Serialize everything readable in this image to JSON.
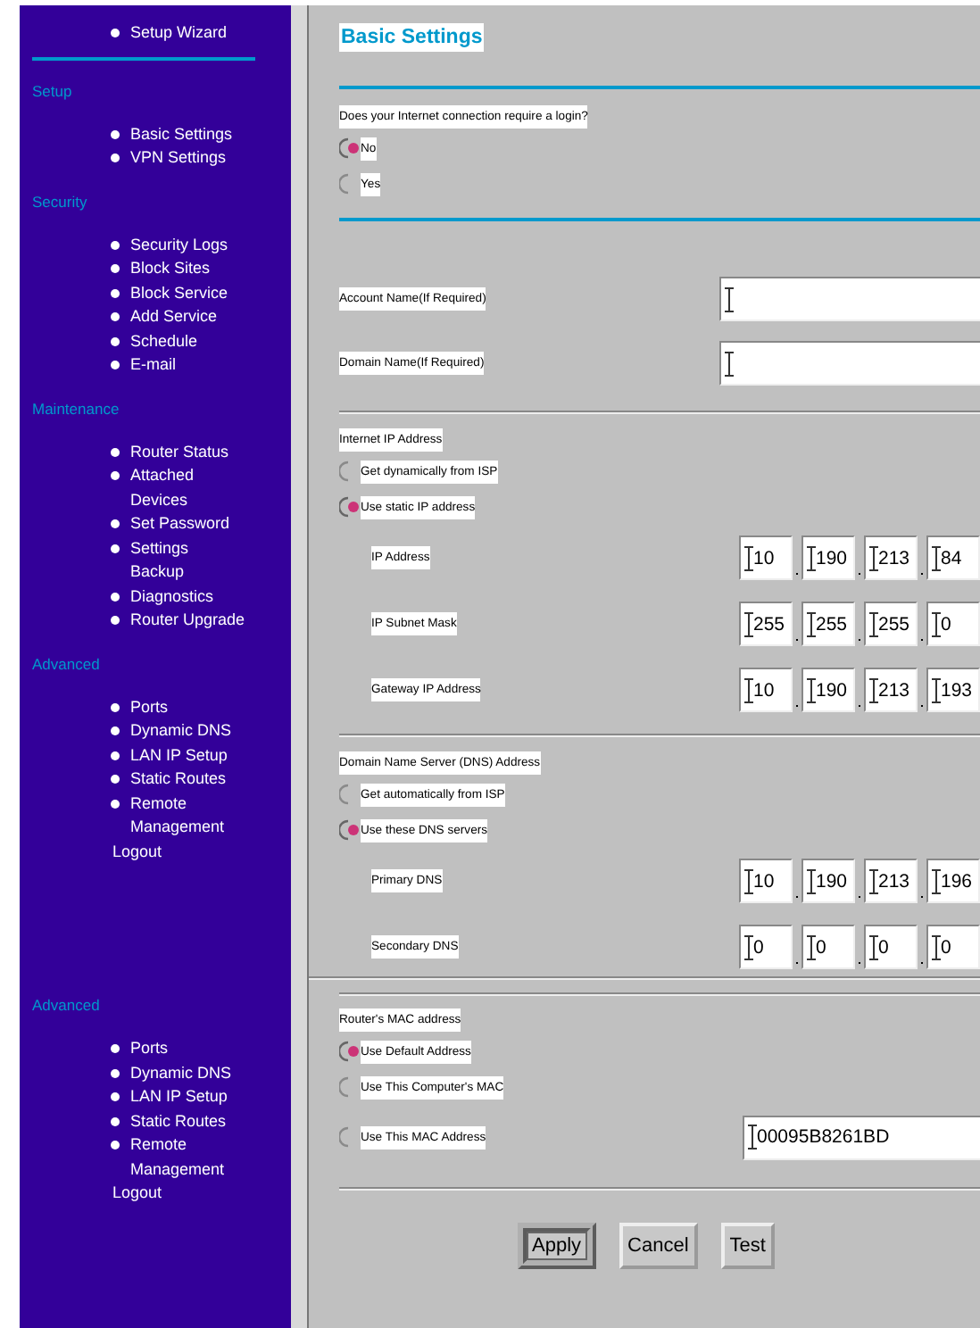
{
  "sidebar": {
    "top_item": {
      "label": "Setup Wizard"
    },
    "sections": [
      {
        "heading": "Setup",
        "items": [
          {
            "kind": "bullet",
            "label": "Basic Settings"
          },
          {
            "kind": "bullet",
            "label": "VPN Settings"
          }
        ]
      },
      {
        "heading": "Security",
        "items": [
          {
            "kind": "bullet",
            "label": "Security Logs"
          },
          {
            "kind": "bullet",
            "label": "Block Sites"
          },
          {
            "kind": "bullet",
            "label": "Block Service"
          },
          {
            "kind": "bullet",
            "label": "Add Service"
          },
          {
            "kind": "bullet",
            "label": "Schedule"
          },
          {
            "kind": "bullet",
            "label": "E-mail"
          }
        ]
      },
      {
        "heading": "Maintenance",
        "items": [
          {
            "kind": "bullet",
            "label": "Router Status"
          },
          {
            "kind": "bullet",
            "label": "Attached\nDevices"
          },
          {
            "kind": "bullet",
            "label": "Set Password"
          },
          {
            "kind": "bullet",
            "label": "Settings\nBackup"
          },
          {
            "kind": "bullet",
            "label": "Diagnostics"
          },
          {
            "kind": "bullet",
            "label": "Router Upgrade"
          }
        ]
      },
      {
        "heading": "Advanced",
        "items": [
          {
            "kind": "bullet",
            "label": "Ports"
          },
          {
            "kind": "bullet",
            "label": "Dynamic DNS"
          },
          {
            "kind": "bullet",
            "label": "LAN IP Setup"
          },
          {
            "kind": "bullet",
            "label": "Static Routes"
          },
          {
            "kind": "bullet",
            "label": "Remote\nManagement"
          },
          {
            "kind": "plain",
            "label": "Logout"
          }
        ]
      },
      {
        "heading": "Advanced",
        "items": [
          {
            "kind": "bullet",
            "label": "Ports"
          },
          {
            "kind": "bullet",
            "label": "Dynamic DNS"
          },
          {
            "kind": "bullet",
            "label": "LAN IP Setup"
          },
          {
            "kind": "bullet",
            "label": "Static Routes"
          },
          {
            "kind": "bullet",
            "label": "Remote\nManagement"
          },
          {
            "kind": "plain",
            "label": "Logout"
          }
        ]
      }
    ]
  },
  "title": "Basic Settings",
  "login": {
    "question": "Does your Internet connection require a login?",
    "options": [
      {
        "label": "No",
        "selected": true
      },
      {
        "label": "Yes",
        "selected": false
      }
    ]
  },
  "account_fields": [
    {
      "label": "Account Name(If Required)"
    },
    {
      "label": "Domain Name(If Required)"
    }
  ],
  "internet_ip": {
    "heading": "Internet IP Address",
    "options": [
      {
        "label": "Get dynamically from ISP",
        "selected": false
      },
      {
        "label": "Use static IP address",
        "selected": true
      }
    ],
    "fields": [
      {
        "label": "IP Address",
        "octets": [
          "10",
          "190",
          "213",
          "84"
        ]
      },
      {
        "label": "IP Subnet Mask",
        "octets": [
          "255",
          "255",
          "255",
          "0"
        ]
      },
      {
        "label": "Gateway IP Address",
        "octets": [
          "10",
          "190",
          "213",
          "193"
        ]
      }
    ]
  },
  "dns": {
    "heading": "Domain Name Server (DNS) Address",
    "options": [
      {
        "label": "Get automatically from ISP",
        "selected": false
      },
      {
        "label": "Use these DNS servers",
        "selected": true
      }
    ],
    "fields": [
      {
        "label": "Primary DNS",
        "octets": [
          "10",
          "190",
          "213",
          "196"
        ]
      },
      {
        "label": "Secondary DNS",
        "octets": [
          "0",
          "0",
          "0",
          "0"
        ]
      }
    ]
  },
  "mac": {
    "heading": "Router's MAC address",
    "options": [
      {
        "label": "Use Default Address",
        "selected": true
      },
      {
        "label": "Use This Computer's MAC",
        "selected": false
      },
      {
        "label": "Use This MAC Address",
        "selected": false
      }
    ],
    "value": "00095B8261BD"
  },
  "buttons": [
    {
      "label": "Apply",
      "default": true
    },
    {
      "label": "Cancel",
      "default": false
    },
    {
      "label": "Test",
      "default": false
    }
  ]
}
